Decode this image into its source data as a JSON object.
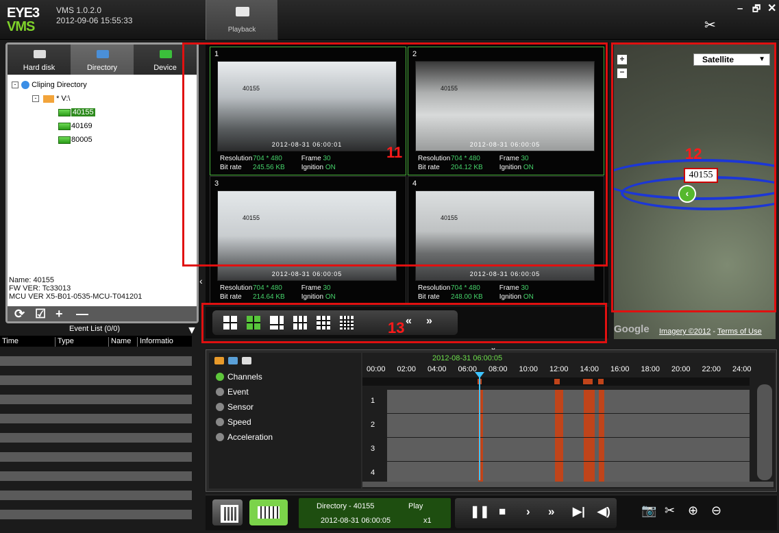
{
  "app": {
    "logo_top": "EYE3",
    "logo_bottom": "VMS",
    "version": "VMS 1.0.2.0",
    "datetime": "2012-09-06 15:55:33",
    "tab": "Playback"
  },
  "window": {
    "min": "–",
    "max": "🗗",
    "close": "✕"
  },
  "left_tabs": [
    "Hard disk",
    "Directory",
    "Device"
  ],
  "tree": {
    "root": "Cliping Directory",
    "drive": "* V:\\",
    "devices": [
      "40155",
      "40169",
      "80005"
    ]
  },
  "device_info": {
    "name": "Name: 40155",
    "fw": "FW VER: Tc33013",
    "mcu": "MCU VER X5-B01-0535-MCU-T041201"
  },
  "event_list": {
    "title": "Event List (0/0)",
    "columns": [
      "Time",
      "Type",
      "Name",
      "Informatio"
    ]
  },
  "cells": [
    {
      "num": "1",
      "timestamp": "2012-08-31 06:00:01",
      "osd": "40155",
      "resolution": "704 * 480",
      "frame": "30",
      "bitrate": "245.56 KB",
      "ignition": "ON"
    },
    {
      "num": "2",
      "timestamp": "2012-08-31 06:00:05",
      "osd": "40155",
      "resolution": "704 * 480",
      "frame": "30",
      "bitrate": "204.12 KB",
      "ignition": "ON"
    },
    {
      "num": "3",
      "timestamp": "2012-08-31 06:00:05",
      "osd": "40155",
      "resolution": "704 * 480",
      "frame": "30",
      "bitrate": "214.64 KB",
      "ignition": "ON"
    },
    {
      "num": "4",
      "timestamp": "2012-08-31 06:00:05",
      "osd": "40155",
      "resolution": "704 * 480",
      "frame": "30",
      "bitrate": "248.00 KB",
      "ignition": "ON"
    }
  ],
  "labels": {
    "resolution": "Resolution",
    "frame": "Frame",
    "bitrate": "Bit rate",
    "ignition": "Ignition"
  },
  "map": {
    "type": "Satellite",
    "marker_label": "40155",
    "google": "Google",
    "imagery": "Imagery ©2012",
    "terms": "Terms of Use",
    "zoom_in": "+",
    "zoom_out": "−"
  },
  "annotations": {
    "a11": "11",
    "a12": "12",
    "a13": "13"
  },
  "timeline": {
    "cursor": "2012-08-31 06:00:05",
    "hours": [
      "00:00",
      "02:00",
      "04:00",
      "06:00",
      "08:00",
      "10:00",
      "12:00",
      "14:00",
      "16:00",
      "18:00",
      "20:00",
      "22:00",
      "24:00"
    ],
    "options": [
      {
        "label": "Channels",
        "on": true
      },
      {
        "label": "Event",
        "on": false
      },
      {
        "label": "Sensor",
        "on": false
      },
      {
        "label": "Speed",
        "on": false
      },
      {
        "label": "Acceleration",
        "on": false
      }
    ],
    "channels": [
      "1",
      "2",
      "3",
      "4"
    ]
  },
  "playback": {
    "directory": "Directory - 40155",
    "state": "Play",
    "time": "2012-08-31 06:00:05",
    "speed": "x1"
  },
  "colors": {
    "accent_green": "#58c53b",
    "record_segment": "#c0441a",
    "cursor": "#3ec4ff",
    "annotation_red": "#e01010"
  }
}
